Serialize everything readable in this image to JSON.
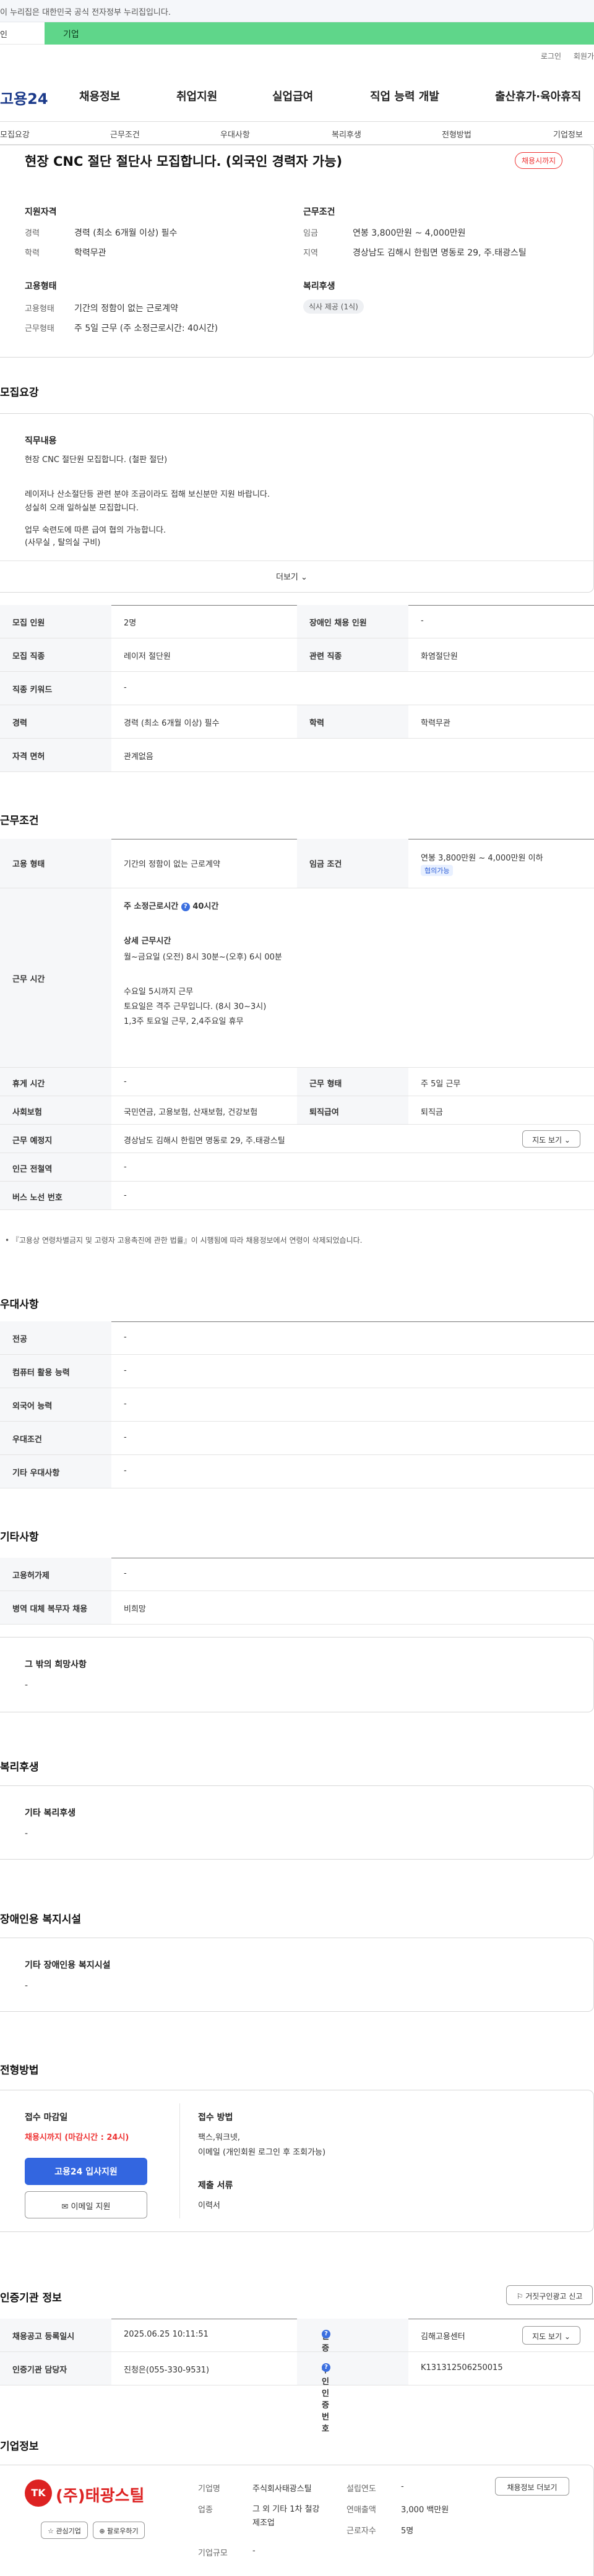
{
  "gov_bar": {
    "text": "이 누리집은 대한민국 공식 전자정부 누리집입니다."
  },
  "topline": {
    "left_text": "인",
    "green_text": "기업"
  },
  "toplinks": [
    "로그인",
    "회원가"
  ],
  "header": {
    "logo": "고용24",
    "menu": [
      "채용정보",
      "취업지원",
      "실업급여",
      "직업 능력 개발",
      "출산휴가·육아휴직"
    ]
  },
  "subnav": [
    "모집요강",
    "근무조건",
    "우대사항",
    "복리후생",
    "전형방법",
    "기업정보"
  ],
  "job": {
    "title": "현장 CNC 절단 절단사 모집합니다. (외국인 경력자 가능)",
    "status_badge": "채용시까지",
    "qualification_heading": "지원자격",
    "qualification": [
      {
        "label": "경력",
        "value": "경력 (최소 6개월 이상) 필수"
      },
      {
        "label": "학력",
        "value": "학력무관"
      }
    ],
    "work_heading": "근무조건",
    "work": [
      {
        "label": "임금",
        "value": "연봉 3,800만원 ~ 4,000만원"
      },
      {
        "label": "지역",
        "value": "경상남도 김해시 한림면 명동로 29, 주.태광스틸"
      }
    ],
    "employment_heading": "고용형태",
    "employment": [
      {
        "label": "고용형태",
        "value": "기간의 정함이 없는 근로계약"
      },
      {
        "label": "근무형태",
        "value": "주 5일 근무 (주 소정근로시간: 40시간)"
      }
    ],
    "welfare_heading": "복리후생",
    "welfare_chip": "식사 제공 (1식)"
  },
  "recruit": {
    "heading": "모집요강",
    "duty_heading": "직무내용",
    "duty_lines": [
      "현장 CNC 절단원 모집합니다.   (철판 절단)",
      "",
      "레이저나 산소절단등 관련 분야 조금이라도 접해 보신분만 지원 바랍니다.",
      "성실히 오래 일하실분 모집합니다.",
      "",
      "업무 숙련도에 따른 급여 협의 가능합니다.",
      "(사무실 , 탈의실 구비)"
    ],
    "more_label": "더보기",
    "rows": [
      [
        "모집 인원",
        "2명",
        "장애인 채용 인원",
        "-"
      ],
      [
        "모집 직종",
        "레이저 절단원",
        "관련 직종",
        "화염절단원"
      ],
      [
        "직종 키워드",
        "-",
        "",
        ""
      ],
      [
        "경력",
        "경력 (최소 6개월 이상) 필수",
        "학력",
        "학력무관"
      ],
      [
        "자격 면허",
        "관계없음",
        "",
        ""
      ]
    ]
  },
  "conditions": {
    "heading": "근무조건",
    "employment_type_label": "고용 형태",
    "employment_type": "기간의 정함이 없는 근로계약",
    "wage_label": "임금 조건",
    "wage": "연봉 3,800만원 ~ 4,000만원 이하",
    "wage_pill": "협의가능",
    "hours_label": "근무 시간",
    "weekly_hours": "주 소정근로시간",
    "weekly_hours_value": "40시간",
    "detail_heading": "상세 근무시간",
    "detail_lines": [
      "월~금요일 (오전) 8시 30분~(오후) 6시 00분",
      "",
      "수요일 5시까지 근무",
      "토요일은 격주 근무입니다.  (8시 30~3시)",
      "1,3주 토요일 근무, 2,4주요일 휴무"
    ],
    "rows": [
      [
        "휴게 시간",
        "-",
        "근무 형태",
        "주 5일 근무"
      ],
      [
        "사회보험",
        "국민연금, 고용보험, 산재보험, 건강보험",
        "퇴직급여",
        "퇴직금"
      ],
      [
        "근무 예정지",
        "경상남도 김해시 한림면 명동로 29, 주.태광스틸",
        "",
        ""
      ],
      [
        "인근 전철역",
        "-",
        "",
        ""
      ],
      [
        "버스 노선 번호",
        "-",
        "",
        ""
      ]
    ],
    "map_button": "지도 보기",
    "note": "• 『고용상 연령차별금지 및 고령자 고용촉진에 관한 법률』이 시행됨에 따라 채용정보에서 연령이 삭제되었습니다."
  },
  "preference": {
    "heading": "우대사항",
    "rows": [
      [
        "전공",
        "-"
      ],
      [
        "컴퓨터 활용 능력",
        "-"
      ],
      [
        "외국어 능력",
        "-"
      ],
      [
        "우대조건",
        "-"
      ],
      [
        "기타 우대사항",
        "-"
      ]
    ]
  },
  "other": {
    "heading": "기타사항",
    "rows": [
      [
        "고용허가제",
        "-"
      ],
      [
        "병역 대체 복무자 채용",
        "비희망"
      ]
    ],
    "wish_heading": "그 밖의 희망사항",
    "wish_value": "-"
  },
  "welfare": {
    "heading": "복리후생",
    "sub": "기타 복리후생",
    "value": "-"
  },
  "disability": {
    "heading": "장애인용 복지시설",
    "sub": "기타 장애인용 복지시설",
    "value": "-"
  },
  "screening": {
    "heading": "전형방법",
    "deadline_label": "접수 마감일",
    "deadline_value": "채용시까지 (마감시간 : 24시)",
    "apply_button": "고용24 입사지원",
    "email_button": "이메일 지원",
    "method_label": "접수 방법",
    "method_lines": [
      "팩스,워크넷,",
      "이메일 (개인회원 로그인 후 조회가능)"
    ],
    "docs_label": "제출 서류",
    "docs_value": "이력서"
  },
  "cert": {
    "heading": "인증기관 정보",
    "report_button": "거짓구인광고 신고",
    "rows": [
      [
        "채용공고 등록일시",
        "2025.06.25 10:11:51",
        "인증기관",
        "김해고용센터"
      ],
      [
        "인증기관 담당자",
        "진청은(055-330-9531)",
        "구인인증번호",
        "K131312506250015"
      ]
    ],
    "map_button": "지도 보기"
  },
  "company": {
    "heading": "기업정보",
    "logo_mark": "TK",
    "logo_text": "(주)태광스틸",
    "fav_button": "관심기업",
    "follow_button": "팔로우하기",
    "info_button": "채용정보 더보기",
    "fields": [
      {
        "label": "기업명",
        "value": "주식회사태광스틸"
      },
      {
        "label": "업종",
        "value": "그 외 기타 1차 철강 제조업"
      },
      {
        "label": "기업규모",
        "value": "-"
      }
    ],
    "fields_right": [
      {
        "label": "설립연도",
        "value": "-"
      },
      {
        "label": "연매출액",
        "value": "3,000 백만원"
      },
      {
        "label": "근로자수",
        "value": "5명"
      }
    ]
  }
}
